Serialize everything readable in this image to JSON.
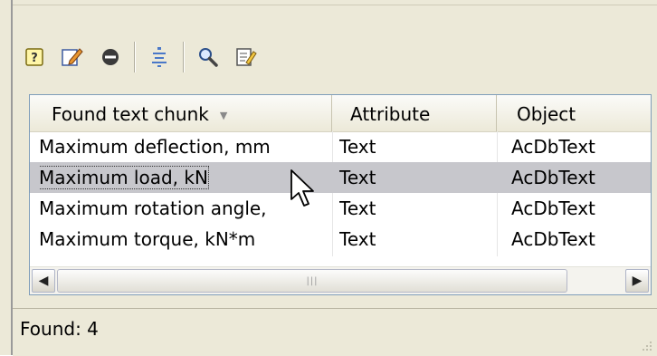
{
  "toolbar": {
    "buttons": [
      {
        "icon": "help-icon"
      },
      {
        "icon": "edit-icon"
      },
      {
        "icon": "remove-icon"
      },
      {
        "icon": "align-center-icon"
      },
      {
        "icon": "search-icon"
      },
      {
        "icon": "properties-icon"
      }
    ]
  },
  "table": {
    "columns": [
      "Found text chunk",
      "Attribute",
      "Object"
    ],
    "rows": [
      {
        "chunk": "Maximum deflection, mm",
        "attribute": "Text",
        "object": "AcDbText",
        "selected": false
      },
      {
        "chunk": "Maximum load, kN",
        "attribute": "Text",
        "object": "AcDbText",
        "selected": true
      },
      {
        "chunk": "Maximum rotation angle,",
        "attribute": "Text",
        "object": "AcDbText",
        "selected": false
      },
      {
        "chunk": "Maximum torque, kN*m",
        "attribute": "Text",
        "object": "AcDbText",
        "selected": false
      }
    ],
    "sort_indicator": "▼"
  },
  "scrollbar": {
    "left_arrow": "◀",
    "right_arrow": "▶",
    "thumb_grip": "|||"
  },
  "status": {
    "text": "Found: 4"
  },
  "colors": {
    "panel_bg": "#ece9d8",
    "selection_bg": "#c7c7cc",
    "table_border": "#7f9db9"
  }
}
